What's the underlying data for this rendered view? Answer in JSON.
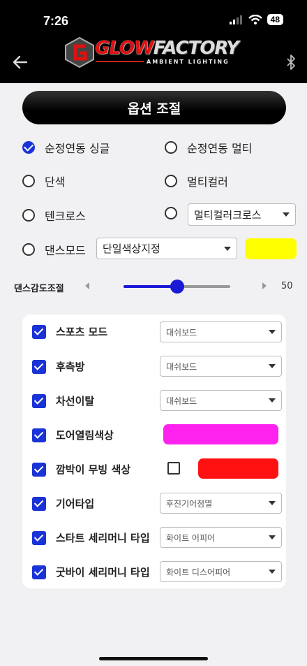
{
  "status": {
    "time": "7:26",
    "battery": "48"
  },
  "header": {
    "logo_main_a": "GLOW",
    "logo_main_b": "FACTORY",
    "logo_sub": "AMBIENT LIGHTING"
  },
  "title": "옵션 조절",
  "modes": {
    "sync_single": "순정연동 싱글",
    "sync_multi": "순정연동 멀티",
    "mono": "단색",
    "multicolor": "멀티컬러",
    "tencross": "텐크로스",
    "multicross_select": "멀티컬러크로스",
    "dance": "댄스모드",
    "dance_select": "단일색상지정",
    "selected": "sync_single"
  },
  "colors": {
    "accent": "#1a33d6",
    "dance_swatch": "#ffff00",
    "door_swatch": "#ff22ee",
    "blink_swatch": "#ff1111"
  },
  "sensitivity": {
    "label": "댄스감도조절",
    "value": 50,
    "value_text": "50",
    "min": 0,
    "max": 100
  },
  "options": [
    {
      "label": "스포츠 모드",
      "select": "대쉬보드",
      "checked": true
    },
    {
      "label": "후측방",
      "select": "대쉬보드",
      "checked": true
    },
    {
      "label": "차선이탈",
      "select": "대쉬보드",
      "checked": true
    },
    {
      "label": "도어열림색상",
      "checked": true
    },
    {
      "label": "깜박이 무빙 색상",
      "checked": true,
      "sub_checked": false
    },
    {
      "label": "기어타입",
      "select": "후진기어점멸",
      "checked": true
    },
    {
      "label": "스타트 세리머니 타입",
      "select": "화이트 어피어",
      "checked": true
    },
    {
      "label": "굿바이 세리머니 타입",
      "select": "화이트 디스어피어",
      "checked": true
    }
  ]
}
